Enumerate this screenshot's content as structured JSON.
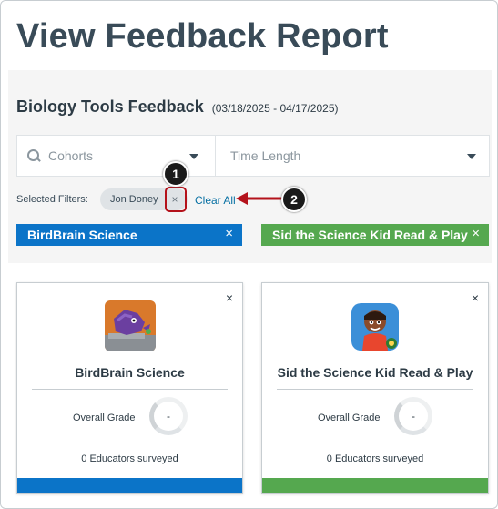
{
  "page": {
    "title": "View Feedback Report"
  },
  "report": {
    "name": "Biology Tools Feedback",
    "date_range": "(03/18/2025 - 04/17/2025)"
  },
  "filters": {
    "cohorts_placeholder": "Cohorts",
    "time_length_placeholder": "Time Length",
    "selected_label": "Selected Filters:",
    "chips": [
      {
        "label": "Jon Doney",
        "remove_glyph": "×"
      }
    ],
    "clear_all_label": "Clear All"
  },
  "callouts": [
    {
      "number": "1"
    },
    {
      "number": "2"
    }
  ],
  "tags": [
    {
      "label": "BirdBrain Science",
      "remove_glyph": "×",
      "color": "#0b74c8"
    },
    {
      "label": "Sid the Science Kid Read & Play",
      "remove_glyph": "×",
      "color": "#55a84f"
    }
  ],
  "cards": [
    {
      "title": "BirdBrain Science",
      "icon": "birdbrain-app-icon",
      "grade_label": "Overall Grade",
      "grade_value": "-",
      "surveyed": "0 Educators surveyed",
      "close_glyph": "×",
      "color": "#0b74c8"
    },
    {
      "title": "Sid the Science Kid Read & Play",
      "icon": "sid-science-app-icon",
      "grade_label": "Overall Grade",
      "grade_value": "-",
      "surveyed": "0 Educators surveyed",
      "close_glyph": "×",
      "color": "#55a84f"
    }
  ],
  "colors": {
    "highlight_red": "#b4121b",
    "link_blue": "#0770a3",
    "title_gray": "#394b58"
  }
}
